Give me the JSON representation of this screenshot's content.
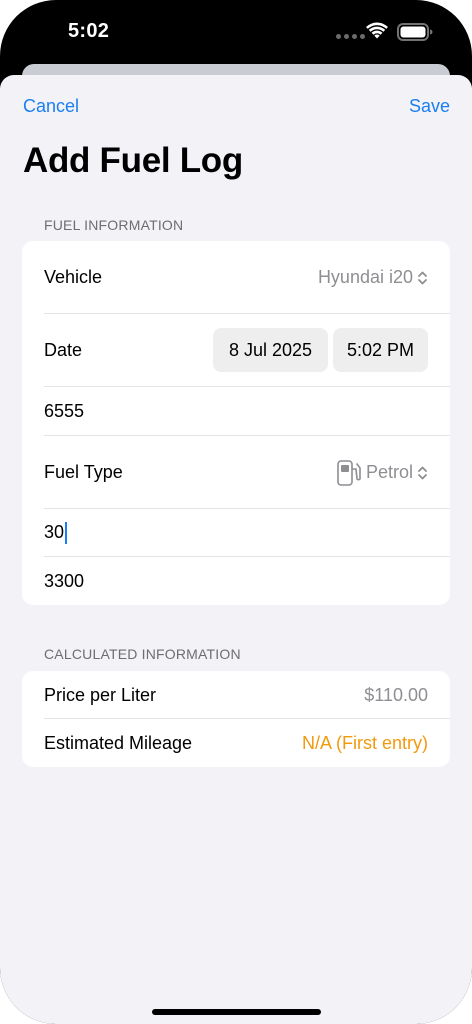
{
  "status": {
    "time": "5:02"
  },
  "nav": {
    "cancel_label": "Cancel",
    "save_label": "Save",
    "title": "Add Fuel Log"
  },
  "fuel_section": {
    "header": "FUEL INFORMATION",
    "vehicle_label": "Vehicle",
    "vehicle_value": "Hyundai i20",
    "date_label": "Date",
    "date_value": "8 Jul 2025",
    "time_value": "5:02 PM",
    "odometer_value": "6555",
    "fuel_type_label": "Fuel Type",
    "fuel_type_value": "Petrol",
    "liters_value": "30",
    "cost_value": "3300"
  },
  "calculated_section": {
    "header": "CALCULATED INFORMATION",
    "price_label": "Price per Liter",
    "price_value": "$110.00",
    "mileage_label": "Estimated Mileage",
    "mileage_value": "N/A (First entry)"
  },
  "colors": {
    "accent": "#1a7ff0",
    "warning": "#f29a0d",
    "background": "#f2f2f7"
  },
  "icons": [
    "wifi-icon",
    "battery-icon",
    "fuel-pump-icon",
    "chevron-updown-icon"
  ]
}
